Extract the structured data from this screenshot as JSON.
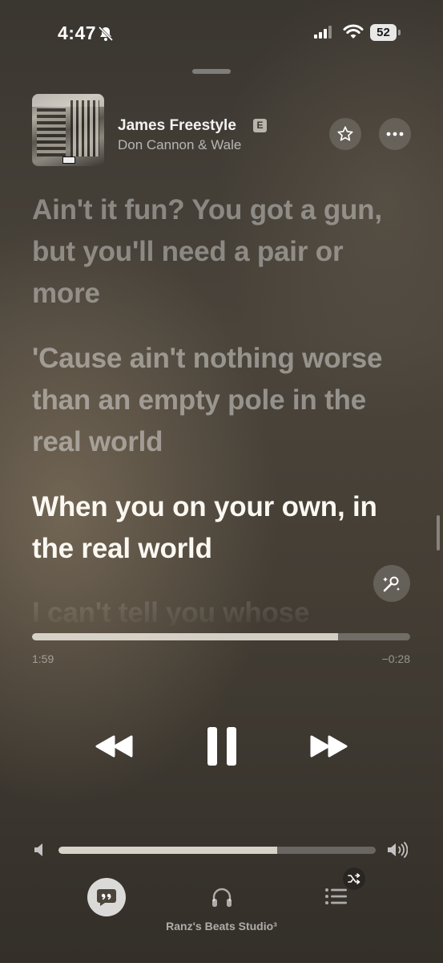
{
  "status_bar": {
    "time": "4:47",
    "battery": "52",
    "icons": [
      "bell-slash-icon",
      "cellular-signal-icon",
      "wifi-icon",
      "battery-icon"
    ]
  },
  "now_playing": {
    "title": "James Freestyle",
    "explicit_badge": "E",
    "artist": "Don Cannon & Wale",
    "artwork": "album-artwork"
  },
  "lyrics": {
    "lines": [
      "Ain't it fun? You got a gun, but you'll need a pair or more",
      "'Cause ain't nothing worse than an empty pole in the real world",
      "When you on your own, in the real world",
      "I can't tell you whose"
    ],
    "active_index": 2
  },
  "progress": {
    "elapsed": "1:59",
    "remaining": "−0:28",
    "fraction": 0.81
  },
  "volume": {
    "fraction": 0.69
  },
  "controls": {
    "icons": [
      "previous-icon",
      "pause-icon",
      "next-icon",
      "star-icon",
      "more-icon",
      "sing-icon",
      "lyrics-icon",
      "airplay-headphones-icon",
      "queue-icon",
      "shuffle-icon"
    ]
  },
  "output_device": {
    "label": "Ranz's Beats Studio³"
  },
  "colors": {
    "background": "#443e35",
    "active_lyric": "#fbf8f2"
  }
}
